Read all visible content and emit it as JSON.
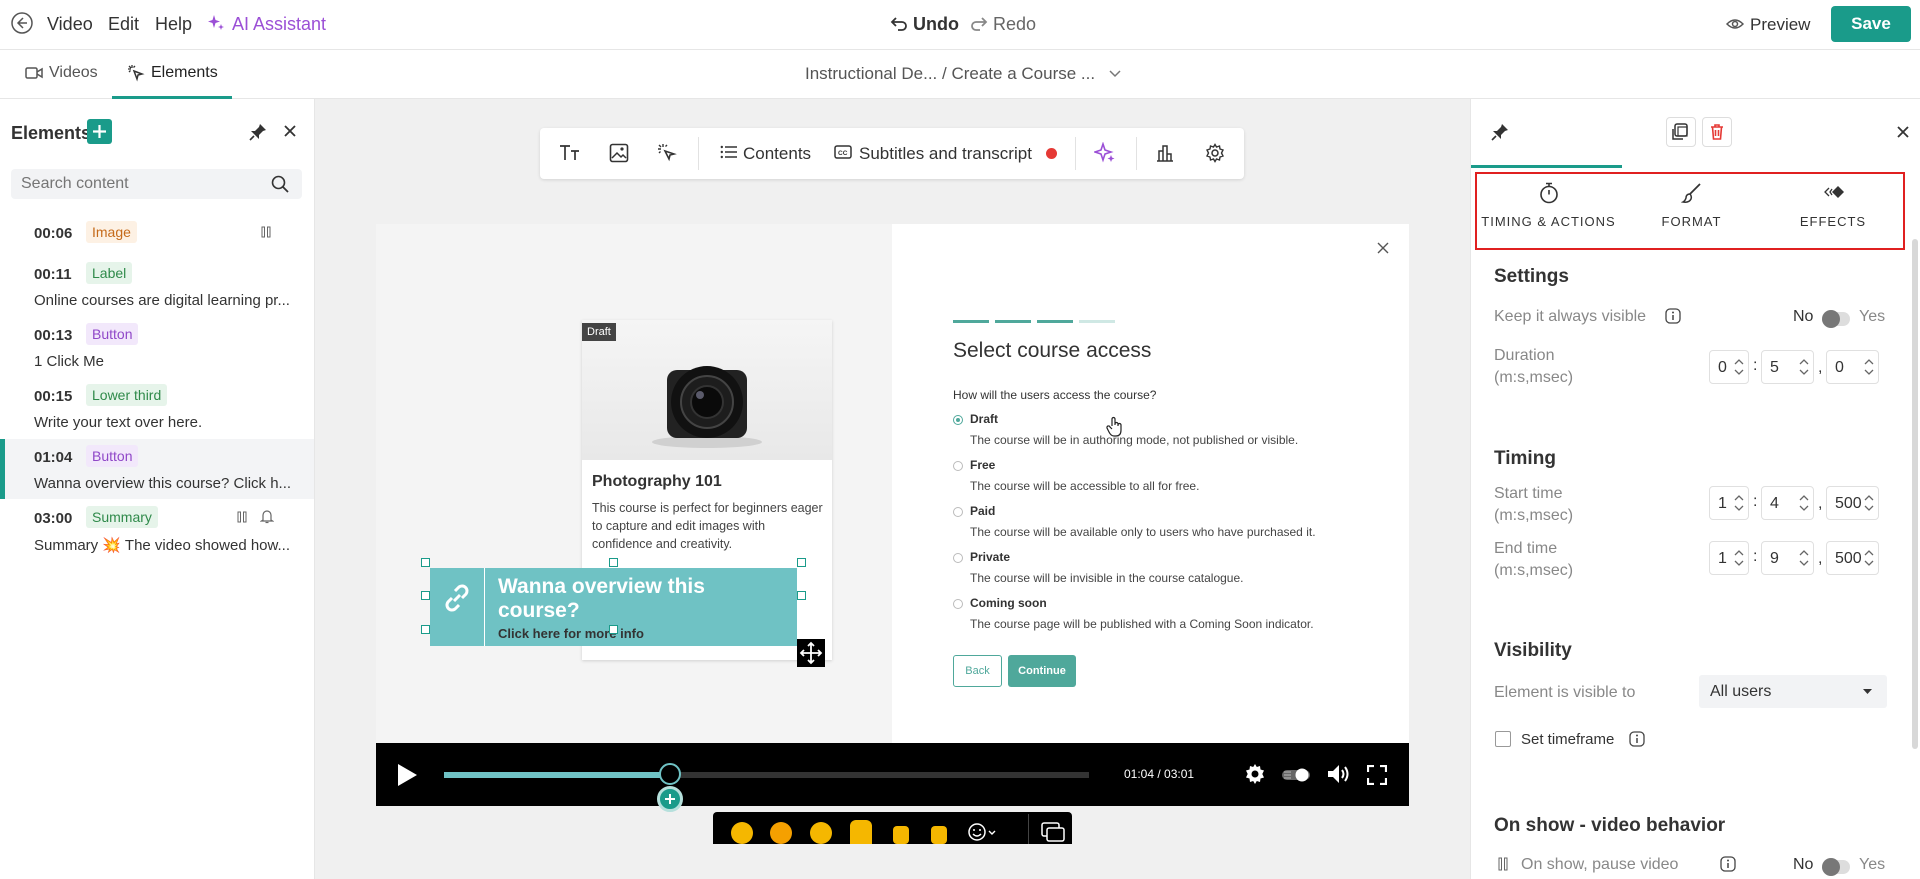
{
  "topbar": {
    "menu": [
      "Video",
      "Edit",
      "Help"
    ],
    "ai_assistant": "AI Assistant",
    "undo": "Undo",
    "redo": "Redo",
    "preview": "Preview",
    "save": "Save"
  },
  "subbar": {
    "tabs": [
      "Videos",
      "Elements"
    ],
    "breadcrumb": "Instructional De...  / Create a Course ..."
  },
  "elements_panel": {
    "title": "Elements",
    "search_placeholder": "Search content",
    "items": [
      {
        "time": "00:06",
        "type": "Image",
        "text": ""
      },
      {
        "time": "00:11",
        "type": "Label",
        "text": "Online courses are digital learning pr..."
      },
      {
        "time": "00:13",
        "type": "Button",
        "text": "1 Click Me"
      },
      {
        "time": "00:15",
        "type": "Lower third",
        "text": "Write your text over here."
      },
      {
        "time": "01:04",
        "type": "Button",
        "text": "Wanna overview this course? Click h..."
      },
      {
        "time": "03:00",
        "type": "Summary",
        "text": "Summary 💥 The video showed how..."
      }
    ]
  },
  "toolbar": {
    "contents": "Contents",
    "subtitles": "Subtitles and transcript"
  },
  "video": {
    "card_badge": "Draft",
    "card_title": "Photography 101",
    "card_desc": "This course is perfect for beginners eager to capture and edit images with confidence and creativity.",
    "overlay_title": "Wanna overview this course?",
    "overlay_sub": "Click here for more info",
    "form_title": "Select course access",
    "form_question": "How will the users access the course?",
    "options": [
      {
        "label": "Draft",
        "desc": "The course will be in authoring mode, not published or visible."
      },
      {
        "label": "Free",
        "desc": "The course will be accessible to all for free."
      },
      {
        "label": "Paid",
        "desc": "The course will be available only to users who have purchased it."
      },
      {
        "label": "Private",
        "desc": "The course will be invisible in the course catalogue."
      },
      {
        "label": "Coming soon",
        "desc": "The course page will be published with a Coming Soon indicator."
      }
    ],
    "back": "Back",
    "continue": "Continue",
    "time": "01:04 / 03:01",
    "progress": 0.35
  },
  "right_panel": {
    "tabs": [
      "TIMING & ACTIONS",
      "FORMAT",
      "EFFECTS"
    ],
    "settings": "Settings",
    "keep_visible": "Keep it always visible",
    "no": "No",
    "yes": "Yes",
    "duration": "Duration",
    "msec_hint": "(m:s,msec)",
    "duration_vals": [
      "0",
      "5",
      "0"
    ],
    "timing": "Timing",
    "start_time": "Start time",
    "start_vals": [
      "1",
      "4",
      "500"
    ],
    "end_time": "End time",
    "end_vals": [
      "1",
      "9",
      "500"
    ],
    "visibility": "Visibility",
    "visible_to": "Element is visible to",
    "visible_value": "All users",
    "set_timeframe": "Set timeframe",
    "on_show": "On show - video behavior",
    "on_show_pause": "On show, pause video"
  },
  "colors": {
    "accent": "#1a9b8a",
    "ai": "#9b4fd6",
    "delete": "#e53935",
    "highlight": "#e02020"
  }
}
